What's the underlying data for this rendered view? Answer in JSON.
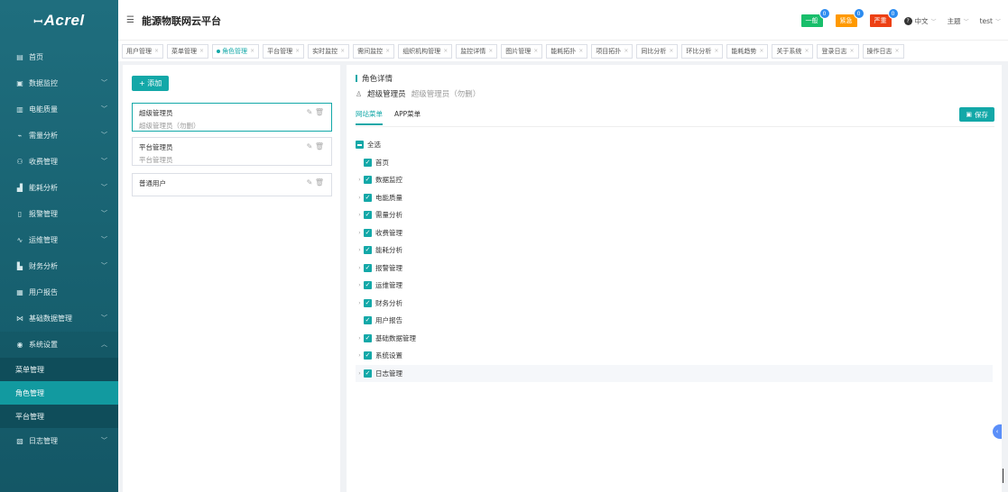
{
  "brand": {
    "mark": "ꟷ",
    "name": "Acrel"
  },
  "header": {
    "title": "能源物联网云平台",
    "levels": [
      {
        "label": "一般",
        "count": "0",
        "color": "#19be6b"
      },
      {
        "label": "紧急",
        "count": "0",
        "color": "#ff9900"
      },
      {
        "label": "严重",
        "count": "0",
        "color": "#ed4014"
      }
    ],
    "language": "中文",
    "theme": "主题",
    "user": "test"
  },
  "sidebar": {
    "items": [
      {
        "label": "首页",
        "icon": "home-icon"
      },
      {
        "label": "数据监控",
        "icon": "monitor-icon"
      },
      {
        "label": "电能质量",
        "icon": "power-quality-icon"
      },
      {
        "label": "需量分析",
        "icon": "demand-icon"
      },
      {
        "label": "收费管理",
        "icon": "billing-icon"
      },
      {
        "label": "能耗分析",
        "icon": "energy-icon"
      },
      {
        "label": "报警管理",
        "icon": "alarm-icon"
      },
      {
        "label": "运维管理",
        "icon": "maintenance-icon"
      },
      {
        "label": "财务分析",
        "icon": "finance-icon"
      },
      {
        "label": "用户报告",
        "icon": "report-icon"
      },
      {
        "label": "基础数据管理",
        "icon": "data-icon"
      },
      {
        "label": "系统设置",
        "icon": "settings-icon"
      },
      {
        "label": "日志管理",
        "icon": "log-icon"
      }
    ],
    "subitems": [
      "菜单管理",
      "角色管理",
      "平台管理"
    ]
  },
  "tabs": [
    "用户管理",
    "菜单管理",
    "角色管理",
    "平台管理",
    "实时监控",
    "需间监控",
    "组织机构管理",
    "监控详情",
    "图片管理",
    "能耗拓扑",
    "项目拓扑",
    "同比分析",
    "环比分析",
    "能耗趋势",
    "关于系统",
    "登录日志",
    "操作日志"
  ],
  "roles": {
    "add_label": "+ 添加",
    "list": [
      {
        "name": "超级管理员",
        "desc": "超级管理员（勿删）"
      },
      {
        "name": "平台管理员",
        "desc": "平台管理员"
      },
      {
        "name": "普通用户",
        "desc": ""
      }
    ]
  },
  "detail": {
    "title": "角色详情",
    "role_name": "超级管理员",
    "role_desc": "超级管理员（勿删）",
    "tabs": [
      "网站菜单",
      "APP菜单"
    ],
    "save_label": "保存",
    "select_all": "全选",
    "menus": [
      {
        "label": "首页",
        "expandable": false
      },
      {
        "label": "数据监控",
        "expandable": true
      },
      {
        "label": "电能质量",
        "expandable": true
      },
      {
        "label": "需量分析",
        "expandable": true
      },
      {
        "label": "收费管理",
        "expandable": true
      },
      {
        "label": "能耗分析",
        "expandable": true
      },
      {
        "label": "报警管理",
        "expandable": true
      },
      {
        "label": "运维管理",
        "expandable": true
      },
      {
        "label": "财务分析",
        "expandable": true
      },
      {
        "label": "用户报告",
        "expandable": false
      },
      {
        "label": "基础数据管理",
        "expandable": true
      },
      {
        "label": "系统设置",
        "expandable": true
      },
      {
        "label": "日志管理",
        "expandable": true
      }
    ]
  }
}
